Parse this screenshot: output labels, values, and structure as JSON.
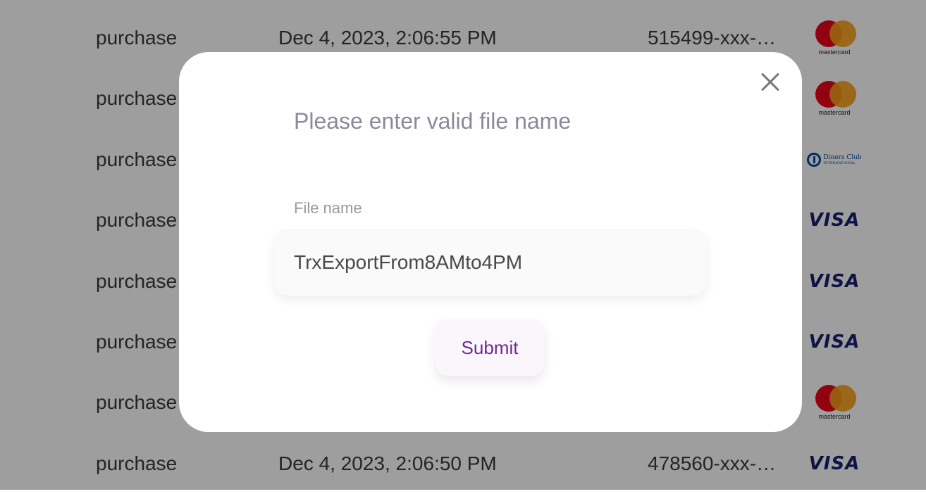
{
  "table": {
    "rows": [
      {
        "type": "purchase",
        "date": "Dec 4, 2023, 2:06:55 PM",
        "card": "515499-xxx-x…",
        "brand": "mastercard"
      },
      {
        "type": "purchase",
        "date": "",
        "card": "",
        "brand": "mastercard"
      },
      {
        "type": "purchase",
        "date": "",
        "card": "",
        "brand": "diners-club"
      },
      {
        "type": "purchase",
        "date": "",
        "card": "",
        "brand": "visa"
      },
      {
        "type": "purchase",
        "date": "",
        "card": "",
        "brand": "visa"
      },
      {
        "type": "purchase",
        "date": "",
        "card": "",
        "brand": "visa"
      },
      {
        "type": "purchase",
        "date": "",
        "card": "",
        "brand": "mastercard"
      },
      {
        "type": "purchase",
        "date": "Dec 4, 2023, 2:06:50 PM",
        "card": "478560-xxx-x…",
        "brand": "visa"
      }
    ],
    "brand_labels": {
      "mastercard": "mastercard",
      "visa": "VISA",
      "diners_line1": "Diners Club",
      "diners_line2": "INTERNATIONAL"
    }
  },
  "modal": {
    "title": "Please enter valid file name",
    "field_label": "File name",
    "field_value": "TrxExportFrom8AMto4PM",
    "submit_label": "Submit",
    "close_icon": "close-icon"
  },
  "colors": {
    "accent": "#6e2c92",
    "overlay": "rgba(0,0,0,0.38)"
  }
}
